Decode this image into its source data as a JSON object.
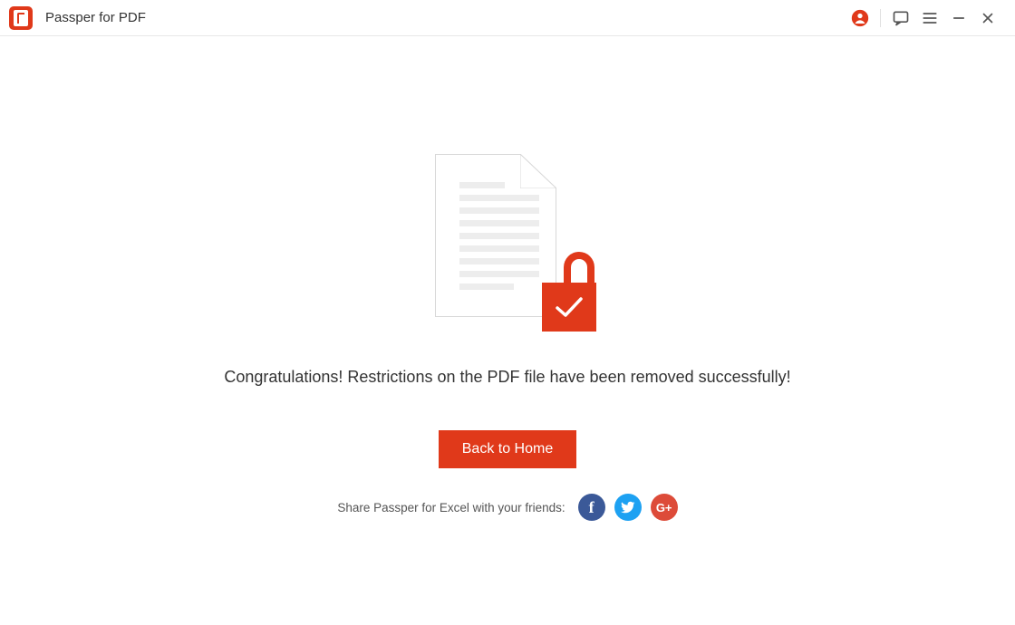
{
  "app": {
    "title": "Passper for PDF"
  },
  "icons": {
    "account": "account-icon",
    "feedback": "chat-icon",
    "menu": "menu-icon",
    "minimize": "minimize-icon",
    "close": "close-icon"
  },
  "result": {
    "message": "Congratulations! Restrictions on the PDF file have been removed successfully!",
    "button_label": "Back to Home"
  },
  "share": {
    "prompt": "Share Passper for Excel with your friends:",
    "facebook": "f",
    "twitter": "t",
    "google_plus": "G+"
  },
  "colors": {
    "accent": "#e0391a"
  }
}
